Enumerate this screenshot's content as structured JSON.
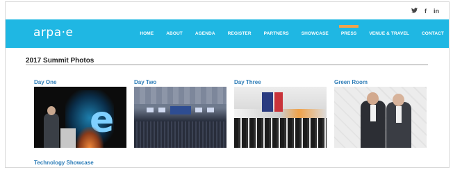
{
  "social": {
    "twitter_icon": "twitter-icon",
    "facebook_label": "f",
    "linkedin_label": "in"
  },
  "brand": {
    "logo_text": "arpa·e"
  },
  "nav": {
    "items": [
      {
        "label": "HOME"
      },
      {
        "label": "ABOUT"
      },
      {
        "label": "AGENDA"
      },
      {
        "label": "REGISTER"
      },
      {
        "label": "PARTNERS"
      },
      {
        "label": "SHOWCASE"
      },
      {
        "label": "PRESS",
        "active": true
      },
      {
        "label": "VENUE & TRAVEL"
      },
      {
        "label": "CONTACT"
      }
    ]
  },
  "page": {
    "section_title": "2017 Summit Photos"
  },
  "albums": [
    {
      "label": "Day One"
    },
    {
      "label": "Day Two"
    },
    {
      "label": "Day Three"
    },
    {
      "label": "Green Room"
    },
    {
      "label": "Technology Showcase"
    }
  ],
  "colors": {
    "nav_bg": "#1fb7e3",
    "active_indicator": "#f0a34c",
    "album_link": "#2c7cb7"
  }
}
